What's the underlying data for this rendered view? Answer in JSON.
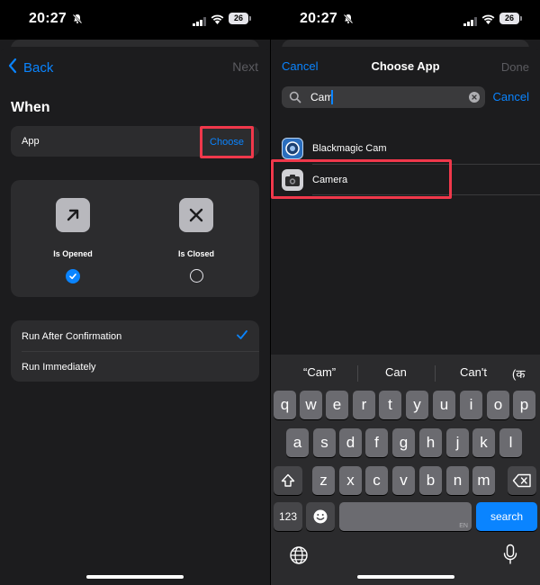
{
  "status_bar": {
    "time": "20:27",
    "battery": "26"
  },
  "left": {
    "nav": {
      "back_label": "Back",
      "next_label": "Next"
    },
    "section_title": "When",
    "app_row": {
      "label": "App",
      "choose_label": "Choose"
    },
    "states": [
      {
        "label": "Is Opened",
        "selected": true
      },
      {
        "label": "Is Closed",
        "selected": false
      }
    ],
    "run_options": [
      {
        "label": "Run After Confirmation",
        "selected": true
      },
      {
        "label": "Run Immediately",
        "selected": false
      }
    ]
  },
  "right": {
    "nav": {
      "cancel_label": "Cancel",
      "title": "Choose App",
      "done_label": "Done"
    },
    "search": {
      "value": "Cam",
      "cancel_label": "Cancel"
    },
    "apps": [
      {
        "name": "Blackmagic Cam"
      },
      {
        "name": "Camera"
      }
    ],
    "keyboard": {
      "suggestions": [
        "“Cam”",
        "Can",
        "Can't",
        "क"
      ],
      "row1": [
        "q",
        "w",
        "e",
        "r",
        "t",
        "y",
        "u",
        "i",
        "o",
        "p"
      ],
      "row2": [
        "a",
        "s",
        "d",
        "f",
        "g",
        "h",
        "j",
        "k",
        "l"
      ],
      "row3": [
        "z",
        "x",
        "c",
        "v",
        "b",
        "n",
        "m"
      ],
      "numbers_label": "123",
      "search_label": "search",
      "language_code": "EN"
    }
  },
  "colors": {
    "accent": "#0a84ff",
    "highlight": "#f0384b",
    "background": "#1c1c1e",
    "card": "#2c2c2e"
  },
  "icons": [
    "bell-slash-icon",
    "cellular-icon",
    "wifi-icon",
    "battery-icon",
    "chevron-left-icon",
    "arrow-up-right-icon",
    "x-mark-icon",
    "checkmark-icon",
    "magnifier-icon",
    "clear-icon",
    "shift-icon",
    "delete-icon",
    "emoji-icon",
    "globe-icon",
    "microphone-icon"
  ]
}
